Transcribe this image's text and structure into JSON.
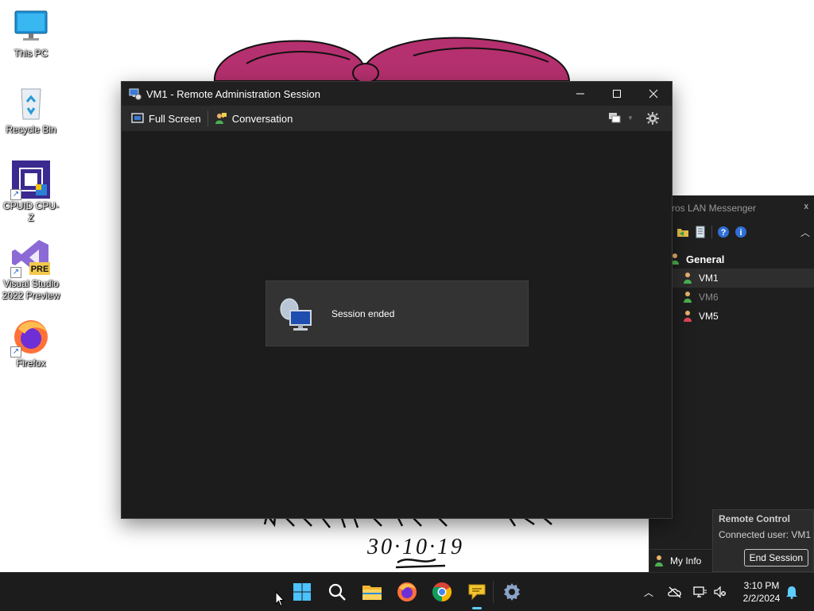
{
  "desktop": {
    "icons": [
      {
        "label": "This PC",
        "icon": "monitor-icon"
      },
      {
        "label": "Recycle Bin",
        "icon": "recycle-bin-icon"
      },
      {
        "label": "CPUID CPU-Z",
        "icon": "cpu-z-icon"
      },
      {
        "label": "Visual Studio 2022 Preview",
        "icon": "visual-studio-icon"
      },
      {
        "label": "Firefox",
        "icon": "firefox-icon"
      }
    ],
    "wallpaper_text": "30·10·19"
  },
  "remote_window": {
    "title": "VM1 - Remote Administration Session",
    "toolbar": {
      "full_screen": "Full Screen",
      "conversation": "Conversation"
    },
    "status": "Session ended"
  },
  "messenger": {
    "title": "ros LAN Messenger",
    "close": "x",
    "group": "General",
    "users": [
      {
        "name": "VM1",
        "state": "selected"
      },
      {
        "name": "VM6",
        "state": "offline"
      },
      {
        "name": "VM5",
        "state": "online"
      }
    ],
    "my_info": "My Info"
  },
  "remote_control": {
    "heading": "Remote Control",
    "status": "Connected user: VM1",
    "end_button": "End Session"
  },
  "taskbar": {
    "apps": [
      "start-icon",
      "search-icon",
      "file-explorer-icon",
      "firefox-icon",
      "chrome-icon",
      "lan-messenger-icon",
      "settings-icon"
    ],
    "clock_time": "3:10 PM",
    "clock_date": "2/2/2024"
  },
  "colors": {
    "accent": "#60cdff",
    "window_bg": "#1c1c1c",
    "wallpaper_bow": "#b5306e"
  }
}
